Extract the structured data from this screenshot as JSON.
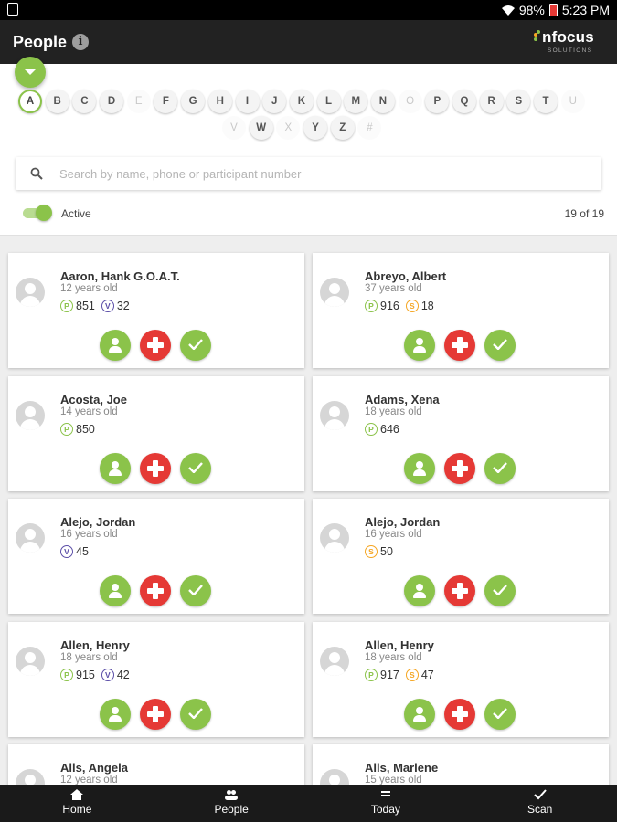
{
  "status_bar": {
    "battery": "98%",
    "time": "5:23 PM"
  },
  "app_bar": {
    "title": "People",
    "logo_text": "nfocus",
    "logo_subtext": "SOLUTIONS"
  },
  "alphabet": {
    "row1": [
      {
        "letter": "A",
        "state": "selected"
      },
      {
        "letter": "B",
        "state": "enabled"
      },
      {
        "letter": "C",
        "state": "enabled"
      },
      {
        "letter": "D",
        "state": "enabled"
      },
      {
        "letter": "E",
        "state": "disabled"
      },
      {
        "letter": "F",
        "state": "enabled"
      },
      {
        "letter": "G",
        "state": "enabled"
      },
      {
        "letter": "H",
        "state": "enabled"
      },
      {
        "letter": "I",
        "state": "enabled"
      },
      {
        "letter": "J",
        "state": "enabled"
      },
      {
        "letter": "K",
        "state": "enabled"
      },
      {
        "letter": "L",
        "state": "enabled"
      },
      {
        "letter": "M",
        "state": "enabled"
      },
      {
        "letter": "N",
        "state": "enabled"
      },
      {
        "letter": "O",
        "state": "disabled"
      },
      {
        "letter": "P",
        "state": "enabled"
      },
      {
        "letter": "Q",
        "state": "enabled"
      },
      {
        "letter": "R",
        "state": "enabled"
      },
      {
        "letter": "S",
        "state": "enabled"
      },
      {
        "letter": "T",
        "state": "enabled"
      },
      {
        "letter": "U",
        "state": "disabled"
      }
    ],
    "row2": [
      {
        "letter": "V",
        "state": "disabled"
      },
      {
        "letter": "W",
        "state": "enabled"
      },
      {
        "letter": "X",
        "state": "disabled"
      },
      {
        "letter": "Y",
        "state": "enabled"
      },
      {
        "letter": "Z",
        "state": "enabled"
      },
      {
        "letter": "#",
        "state": "disabled"
      }
    ]
  },
  "search": {
    "placeholder": "Search by name, phone or participant number",
    "value": ""
  },
  "filter": {
    "active_label": "Active",
    "active_on": true,
    "count": "19 of 19"
  },
  "people": [
    {
      "name": "Aaron, Hank G.O.A.T.",
      "age": "12 years old",
      "badges": [
        {
          "type": "P",
          "value": "851"
        },
        {
          "type": "V",
          "value": "32"
        }
      ]
    },
    {
      "name": "Abreyo, Albert",
      "age": "37 years old",
      "badges": [
        {
          "type": "P",
          "value": "916"
        },
        {
          "type": "S",
          "value": "18"
        }
      ]
    },
    {
      "name": "Acosta, Joe",
      "age": "14 years old",
      "badges": [
        {
          "type": "P",
          "value": "850"
        }
      ]
    },
    {
      "name": "Adams, Xena",
      "age": "18 years old",
      "badges": [
        {
          "type": "P",
          "value": "646"
        }
      ]
    },
    {
      "name": "Alejo, Jordan",
      "age": "16 years old",
      "badges": [
        {
          "type": "V",
          "value": "45"
        }
      ]
    },
    {
      "name": "Alejo, Jordan",
      "age": "16 years old",
      "badges": [
        {
          "type": "S",
          "value": "50"
        }
      ]
    },
    {
      "name": "Allen, Henry",
      "age": "18 years old",
      "badges": [
        {
          "type": "P",
          "value": "915"
        },
        {
          "type": "V",
          "value": "42"
        }
      ]
    },
    {
      "name": "Allen, Henry",
      "age": "18 years old",
      "badges": [
        {
          "type": "P",
          "value": "917"
        },
        {
          "type": "S",
          "value": "47"
        }
      ]
    },
    {
      "name": "Alls, Angela",
      "age": "12 years old",
      "badges": []
    },
    {
      "name": "Alls, Marlene",
      "age": "15 years old",
      "badges": []
    }
  ],
  "bottom_nav": [
    {
      "label": "Home",
      "icon": "home-icon"
    },
    {
      "label": "People",
      "icon": "people-icon"
    },
    {
      "label": "Today",
      "icon": "list-icon"
    },
    {
      "label": "Scan",
      "icon": "check-icon"
    }
  ],
  "colors": {
    "accent": "#8bc34a",
    "danger": "#e53935",
    "appbar": "#222222",
    "badge_p": "#8bc34a",
    "badge_v": "#5c4fa8",
    "badge_s": "#f5a623"
  }
}
